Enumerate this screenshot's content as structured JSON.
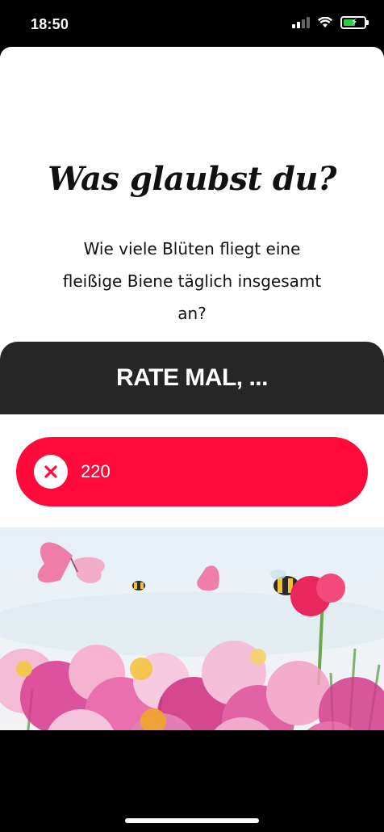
{
  "status": {
    "time": "18:50",
    "icons": [
      "signal-icon",
      "wifi-icon",
      "battery-charging-icon"
    ]
  },
  "card": {
    "script_title": "Was glaubst du?",
    "question_lines": [
      "Wie viele Blüten fliegt eine",
      "fleißige Biene täglich insgesamt",
      "an?"
    ],
    "rate_label": "RATE MAL, ...",
    "answer": {
      "value": "220",
      "icon": "close-icon",
      "color": "#ff0a3b"
    }
  },
  "colors": {
    "background": "#ffffff",
    "dark_bar": "#262626",
    "accent": "#ff0a3b"
  }
}
